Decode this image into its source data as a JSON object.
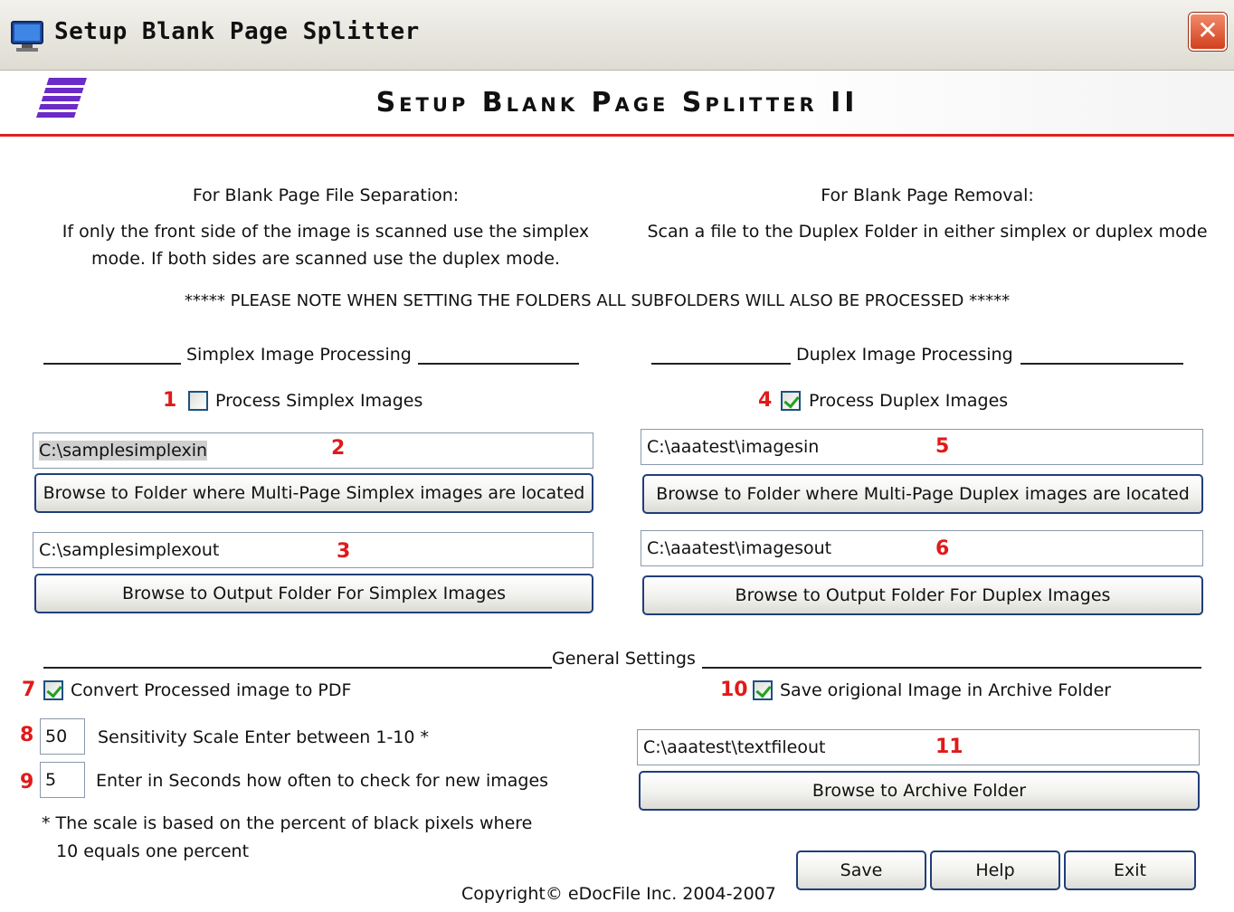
{
  "window": {
    "title": "Setup Blank Page Splitter",
    "close_label": "✕",
    "icon": "monitor-icon"
  },
  "banner": {
    "title": "Setup Blank Page Splitter II",
    "logo": "edocfile-logo"
  },
  "info": {
    "left_heading": "For Blank Page File Separation:",
    "left_line1": "If only the front side of the image is scanned use the simplex",
    "left_line2": "mode. If both sides are scanned use the duplex mode.",
    "right_heading": "For Blank Page Removal:",
    "right_line1": "Scan a file to the Duplex Folder in either simplex or duplex mode",
    "note": "***** PLEASE NOTE WHEN SETTING THE FOLDERS ALL SUBFOLDERS WILL ALSO BE PROCESSED *****"
  },
  "simplex": {
    "section_label": "Simplex Image Processing",
    "process_label": "Process Simplex Images",
    "process_checked": false,
    "input_folder": "C:\\samplesimplexin",
    "browse_input_label": "Browse to Folder where Multi-Page Simplex images are located",
    "output_folder": "C:\\samplesimplexout",
    "browse_output_label": "Browse to Output Folder For Simplex Images"
  },
  "duplex": {
    "section_label": "Duplex Image Processing",
    "process_label": "Process Duplex Images",
    "process_checked": true,
    "input_folder": "C:\\aaatest\\imagesin",
    "browse_input_label": "Browse to Folder where Multi-Page Duplex images are located",
    "output_folder": "C:\\aaatest\\imagesout",
    "browse_output_label": "Browse to Output Folder For Duplex Images"
  },
  "general": {
    "section_label": "General Settings",
    "convert_pdf_label": "Convert Processed image to PDF",
    "convert_pdf_checked": true,
    "sensitivity_value": "50",
    "sensitivity_label": "Sensitivity Scale Enter between 1-10 *",
    "interval_value": "5",
    "interval_label": "Enter in Seconds how often to check for new images",
    "footnote_line1": "* The scale is based on the percent of black pixels where",
    "footnote_line2": "10 equals one percent",
    "archive_label": "Save origional Image in Archive Folder",
    "archive_checked": true,
    "archive_folder": "C:\\aaatest\\textfileout",
    "browse_archive_label": "Browse to Archive Folder"
  },
  "markers": [
    "1",
    "2",
    "3",
    "4",
    "5",
    "6",
    "7",
    "8",
    "9",
    "10",
    "11"
  ],
  "buttons": {
    "save": "Save",
    "help": "Help",
    "exit": "Exit"
  },
  "copyright": "Copyright© eDocFile Inc. 2004-2007",
  "colors": {
    "accent_red": "#e0201c",
    "marker_red": "#e01a1a",
    "button_border": "#1f3f7a",
    "check_green": "#21a121"
  }
}
